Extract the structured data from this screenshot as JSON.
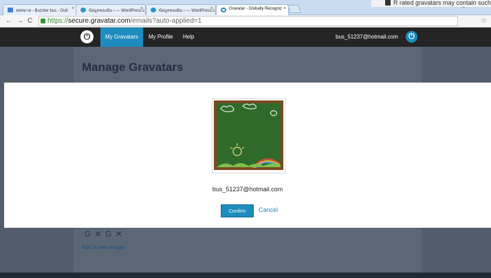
{
  "external_note": {
    "text": "R rated gravatars may contain such t"
  },
  "browser": {
    "tabs": [
      {
        "label": "จดหมาย - Buzzter bus - Outl",
        "favicon": "mail-icon",
        "active": false
      },
      {
        "label": "ข้อมูลของฉัน ‹ — WordPress.c",
        "favicon": "wordpress-icon",
        "active": false
      },
      {
        "label": "ข้อมูลของฉัน ‹ — WordPress.c",
        "favicon": "wordpress-icon",
        "active": false
      },
      {
        "label": "Gravatar - Globally Recogniz",
        "favicon": "gravatar-icon",
        "active": true
      }
    ],
    "tab_close_glyph": "×",
    "url": {
      "scheme": "https://",
      "host": "secure.gravatar.com",
      "path": "/emails?auto-applied=1"
    }
  },
  "header": {
    "menu": [
      "My Gravatars",
      "My Profile",
      "Help"
    ],
    "user_email": "bus_51237@hotmail.com",
    "accent_color": "#1e8cbe"
  },
  "page": {
    "title": "Manage Gravatars",
    "add_image_label": "Add a new image",
    "background_row": "G ✕ G ✕"
  },
  "modal": {
    "email": "bus_51237@hotmail.com",
    "confirm_label": "Confirm",
    "cancel_label": "Cancel",
    "avatar_description": "chalkboard-drawing-avatar"
  }
}
